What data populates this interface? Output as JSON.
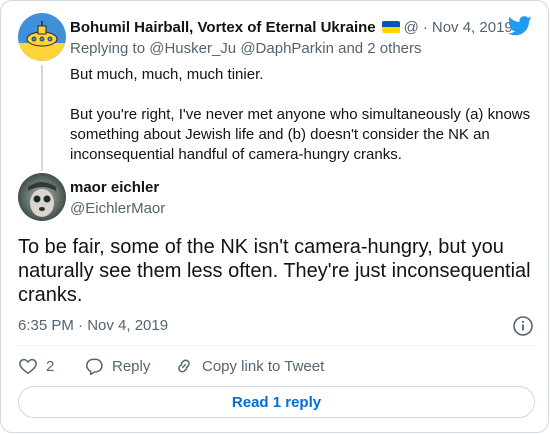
{
  "parent_tweet": {
    "author_name": "Bohumil Hairball, Vortex of Eternal Ukraine",
    "handle_truncated": "@",
    "separator": "·",
    "date": "Nov 4, 2019",
    "replying_prefix": "Replying to ",
    "mention1": "@Husker_Ju",
    "mention2": "@DaphParkin",
    "replying_suffix": " and 2 others",
    "paragraph1": "But much, much, much tinier.",
    "paragraph2": "But you're right, I've never met anyone who simultaneously (a) knows something about Jewish life and (b) doesn't consider the NK an inconsequential handful of camera-hungry cranks."
  },
  "main_tweet": {
    "author_name": "maor eichler",
    "handle": "@EichlerMaor",
    "text": "To be fair, some of the NK isn't camera-hungry, but you naturally see them less often. They're just inconsequential cranks.",
    "timestamp": "6:35 PM · Nov 4, 2019"
  },
  "actions": {
    "like_count": "2",
    "reply_label": "Reply",
    "copy_link_label": "Copy link to Tweet"
  },
  "read_replies_label": "Read 1 reply",
  "icons": {
    "brand": "twitter-bird-icon",
    "info": "info-icon",
    "like": "heart-icon",
    "reply": "speech-bubble-icon",
    "copy_link": "link-icon"
  },
  "colors": {
    "brand_blue": "#1d9bf0",
    "link_blue": "#006fd6",
    "secondary_text": "#536471",
    "flag_blue": "#0057b7",
    "flag_yellow": "#ffd700"
  }
}
